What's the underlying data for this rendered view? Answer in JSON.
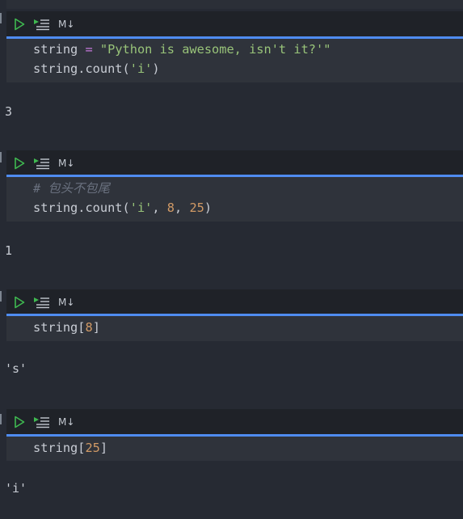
{
  "toolbar": {
    "run_icon": "play-icon",
    "run_below_icon": "run-below-icon",
    "markdown_label": "M↓"
  },
  "cells": [
    {
      "code": [
        [
          {
            "t": "string ",
            "k": "plain"
          },
          {
            "t": "=",
            "k": "op"
          },
          {
            "t": " ",
            "k": "plain"
          },
          {
            "t": "\"Python is awesome, isn't it?'\"",
            "k": "str"
          }
        ],
        [
          {
            "t": "string.count(",
            "k": "plain"
          },
          {
            "t": "'i'",
            "k": "str"
          },
          {
            "t": ")",
            "k": "plain"
          }
        ]
      ],
      "output": "3"
    },
    {
      "code": [
        [
          {
            "t": "# 包头不包尾",
            "k": "com"
          }
        ],
        [
          {
            "t": "string.count(",
            "k": "plain"
          },
          {
            "t": "'i'",
            "k": "str"
          },
          {
            "t": ", ",
            "k": "plain"
          },
          {
            "t": "8",
            "k": "num"
          },
          {
            "t": ", ",
            "k": "plain"
          },
          {
            "t": "25",
            "k": "num"
          },
          {
            "t": ")",
            "k": "plain"
          }
        ]
      ],
      "output": "1"
    },
    {
      "code": [
        [
          {
            "t": "string[",
            "k": "plain"
          },
          {
            "t": "8",
            "k": "num"
          },
          {
            "t": "]",
            "k": "plain"
          }
        ]
      ],
      "output": "'s'"
    },
    {
      "code": [
        [
          {
            "t": "string[",
            "k": "plain"
          },
          {
            "t": "25",
            "k": "num"
          },
          {
            "t": "]",
            "k": "plain"
          }
        ]
      ],
      "output": "'i'"
    }
  ],
  "colors": {
    "background": "#262a33",
    "toolbar": "#1f2228",
    "editor": "#2f333b",
    "active_indicator": "#4f8cf0",
    "string": "#98c379",
    "number": "#d19a66",
    "operator": "#c678dd",
    "comment": "#6b7280",
    "run_icon": "#3fb950"
  }
}
